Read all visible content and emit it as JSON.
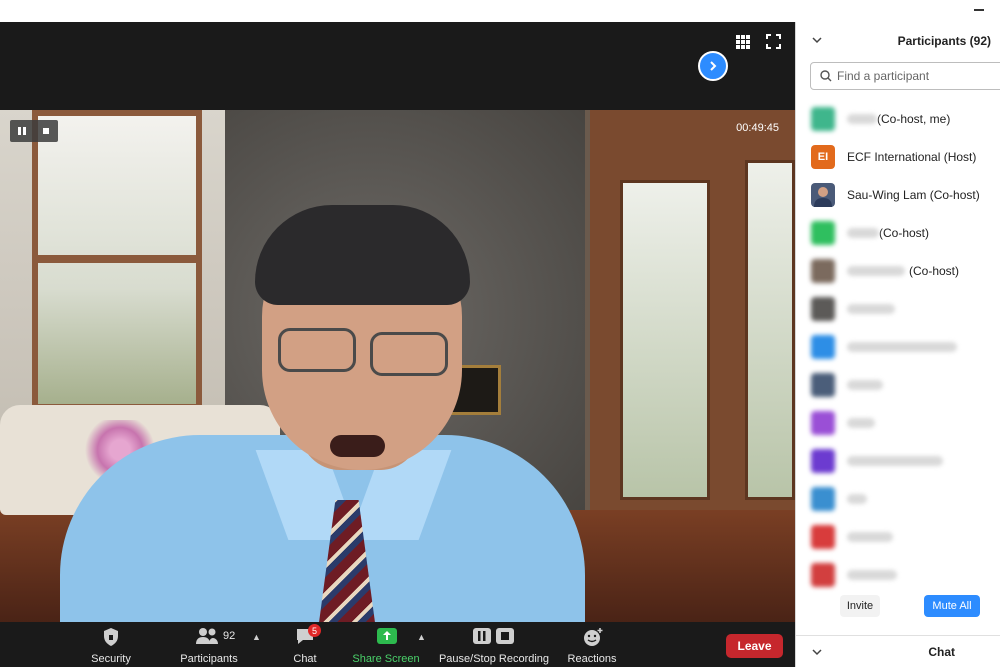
{
  "meeting": {
    "timer": "00:49:45"
  },
  "toolbar": {
    "security_label": "Security",
    "participants_label": "Participants",
    "participants_count": "92",
    "chat_label": "Chat",
    "chat_badge": "5",
    "share_label": "Share Screen",
    "recording_label": "Pause/Stop Recording",
    "reactions_label": "Reactions",
    "leave_label": "Leave",
    "share_color": "#2dba4e",
    "leave_color": "#c6272d"
  },
  "panel": {
    "title": "Participants (92)",
    "search_placeholder": "Find a participant",
    "participants": [
      {
        "avatar_color": "#3fb68c",
        "initials": "",
        "suffix": "(Co-host, me)"
      },
      {
        "avatar_color": "#e26a1c",
        "initials": "EI",
        "name": "ECF International (Host)"
      },
      {
        "avatar_color": "#4a5a78",
        "initials": "",
        "name": "Sau-Wing Lam (Co-host)"
      },
      {
        "avatar_color": "#2fbf5f",
        "initials": "",
        "suffix": "(Co-host)"
      },
      {
        "avatar_color": "#7b6a5e",
        "initials": "",
        "suffix": "(Co-host)"
      },
      {
        "avatar_color": "#5c5a58",
        "initials": ""
      },
      {
        "avatar_color": "#2d8ee6",
        "initials": ""
      },
      {
        "avatar_color": "#4b5e7a",
        "initials": ""
      },
      {
        "avatar_color": "#9a4fd6",
        "initials": ""
      },
      {
        "avatar_color": "#6c3bd0",
        "initials": ""
      },
      {
        "avatar_color": "#3a8fd0",
        "initials": ""
      },
      {
        "avatar_color": "#d83c3c",
        "initials": ""
      },
      {
        "avatar_color": "#d23f3f",
        "initials": ""
      }
    ],
    "invite_label": "Invite",
    "mute_all_label": "Mute All",
    "chat_title": "Chat",
    "accent": "#2d8cff"
  }
}
